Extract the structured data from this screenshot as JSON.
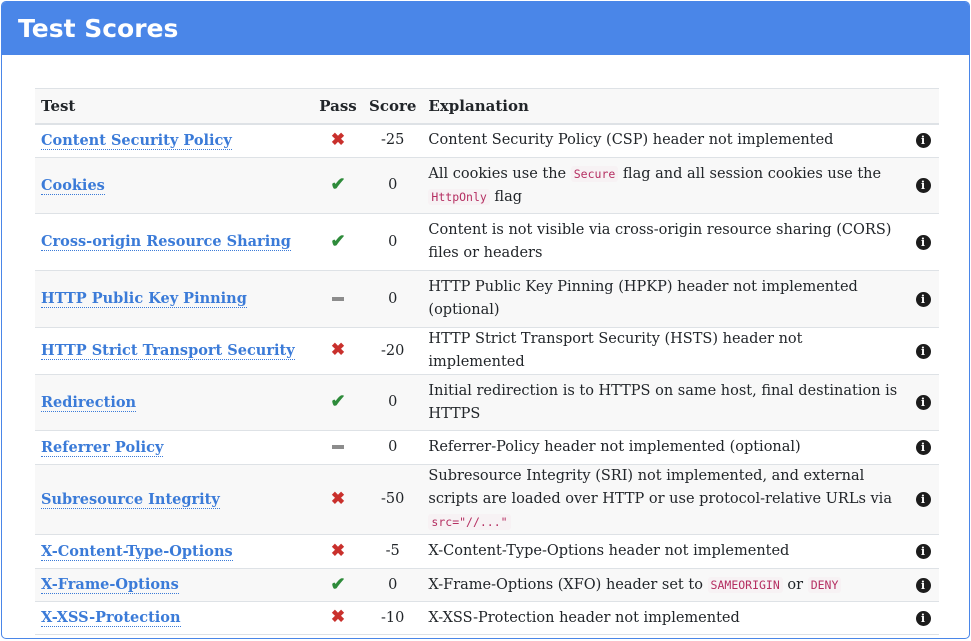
{
  "header": {
    "title": "Test Scores"
  },
  "table": {
    "columns": {
      "test": "Test",
      "pass": "Pass",
      "score": "Score",
      "explanation": "Explanation"
    },
    "rows": [
      {
        "test": "Content Security Policy",
        "pass": "fail",
        "score": "-25",
        "parts": [
          {
            "t": "Content Security Policy (CSP) header not implemented"
          }
        ],
        "height": 34
      },
      {
        "test": "Cookies",
        "pass": "pass",
        "score": "0",
        "parts": [
          {
            "t": "All cookies use the "
          },
          {
            "c": "Secure"
          },
          {
            "t": " flag and all session cookies use the "
          },
          {
            "c": "HttpOnly"
          },
          {
            "t": " flag"
          }
        ],
        "height": 56
      },
      {
        "test": "Cross-origin Resource Sharing",
        "pass": "pass",
        "score": "0",
        "parts": [
          {
            "t": "Content is not visible via cross-origin resource sharing (CORS) files or headers"
          }
        ],
        "height": 57
      },
      {
        "test": "HTTP Public Key Pinning",
        "pass": "neutral",
        "score": "0",
        "parts": [
          {
            "t": "HTTP Public Key Pinning (HPKP) header not implemented (optional)"
          }
        ],
        "height": 57
      },
      {
        "test": "HTTP Strict Transport Security",
        "pass": "fail",
        "score": "-20",
        "parts": [
          {
            "t": "HTTP Strict Transport Security (HSTS) header not implemented"
          }
        ],
        "height": 34
      },
      {
        "test": "Redirection",
        "pass": "pass",
        "score": "0",
        "parts": [
          {
            "t": "Initial redirection is to HTTPS on same host, final destination is HTTPS"
          }
        ],
        "height": 56
      },
      {
        "test": "Referrer Policy",
        "pass": "neutral",
        "score": "0",
        "parts": [
          {
            "t": "Referrer-Policy header not implemented (optional)"
          }
        ],
        "height": 34
      },
      {
        "test": "Subresource Integrity",
        "pass": "fail",
        "score": "-50",
        "parts": [
          {
            "t": "Subresource Integrity (SRI) not implemented, and external scripts are loaded over HTTP or use protocol-relative URLs via "
          },
          {
            "c": "src=\"//...\""
          }
        ],
        "height": 57
      },
      {
        "test": "X-Content-Type-Options",
        "pass": "fail",
        "score": "-5",
        "parts": [
          {
            "t": "X-Content-Type-Options header not implemented"
          }
        ],
        "height": 34
      },
      {
        "test": "X-Frame-Options",
        "pass": "pass",
        "score": "0",
        "parts": [
          {
            "t": "X-Frame-Options (XFO) header set to "
          },
          {
            "c": "SAMEORIGIN"
          },
          {
            "t": " or "
          },
          {
            "c": "DENY"
          }
        ],
        "height": 33
      },
      {
        "test": "X-XSS-Protection",
        "pass": "fail",
        "score": "-10",
        "parts": [
          {
            "t": "X-XSS-Protection header not implemented"
          }
        ],
        "height": 33
      }
    ]
  },
  "icons": {
    "fail": "cross-icon",
    "pass": "check-icon",
    "neutral": "minus-icon",
    "info": "info-icon"
  },
  "colors": {
    "accent": "#4a86e8",
    "link": "#3b7bd8",
    "fail": "#c9302c",
    "pass": "#2e8b3a",
    "neutral": "#8c8c8c"
  }
}
